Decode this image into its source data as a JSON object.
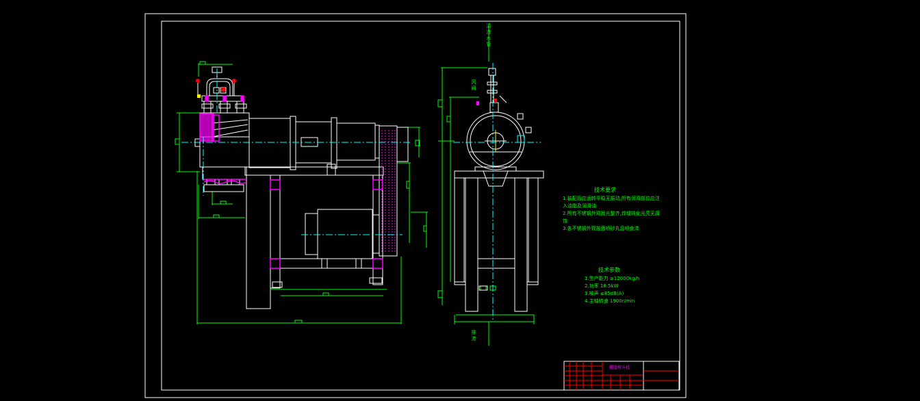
{
  "drawing": {
    "colors": {
      "background": "#000000",
      "outline": "#ffffff",
      "dimension": "#00ff00",
      "centerline": "#00ffff",
      "highlight": "#ff00ff",
      "fitting": "#ff0000",
      "accent": "#ffff00"
    }
  },
  "labels": {
    "top_vertical": "清洗水管",
    "upper_vertical": "风阀",
    "bottom_vertical": "排渣"
  },
  "tech_requirements": {
    "title": "技术要求",
    "lines": [
      "1.装配后应运转平稳无振动,所有润滑部位应注",
      "入油脂及润滑油",
      "2.所有不锈钢外观抛光整齐,焊缝钝化光亮无腐",
      "蚀",
      "3.各不锈钢外观按面喷砂丸后喷金漆"
    ]
  },
  "tech_params": {
    "title": "技术参数",
    "lines": [
      "1.生产能力 ≥12000kg/h",
      "2.功率 18.5kW",
      "3.噪声 ≤85dB(A)",
      "4.主轴转速 1900r/min"
    ]
  },
  "title_block": {
    "drawing_name": "螺旋榨汁机"
  }
}
